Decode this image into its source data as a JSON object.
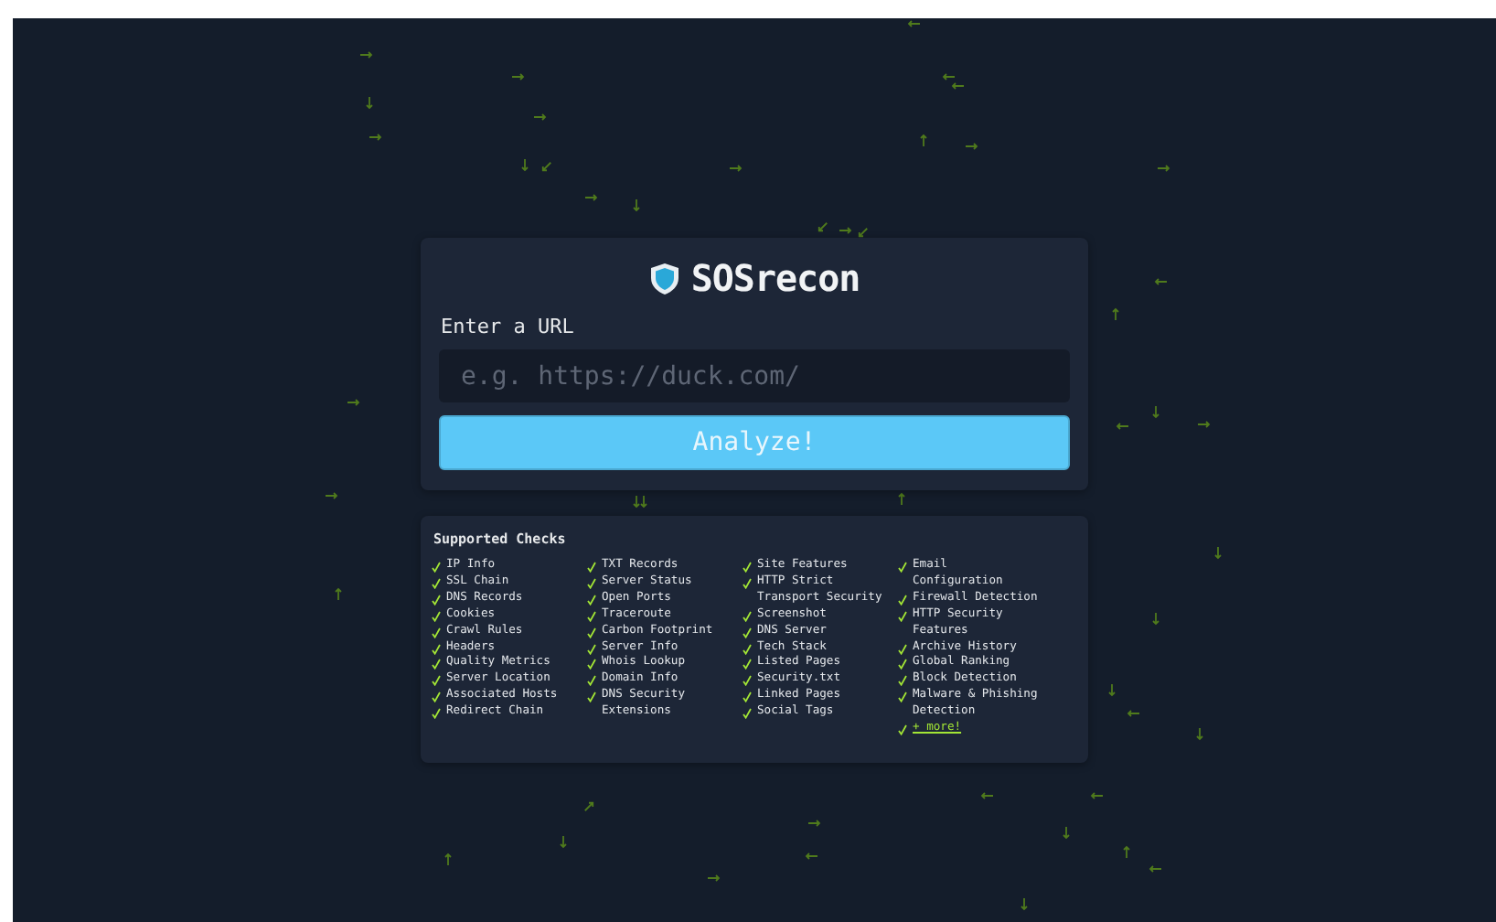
{
  "app": {
    "title": "SOSrecon"
  },
  "url_form": {
    "label": "Enter a URL",
    "placeholder": "e.g. https://duck.com/",
    "button": "Analyze!"
  },
  "checks": {
    "title": "Supported Checks",
    "columns": [
      [
        {
          "label": "IP Info",
          "kind": "item"
        },
        {
          "label": "SSL Chain",
          "kind": "item"
        },
        {
          "label": "DNS Records",
          "kind": "item"
        },
        {
          "label": "Cookies",
          "kind": "item"
        },
        {
          "label": "Crawl Rules",
          "kind": "item"
        },
        {
          "label": "Headers",
          "kind": "item"
        },
        {
          "label": "Quality Metrics",
          "kind": "item"
        },
        {
          "label": "Server Location",
          "kind": "item"
        },
        {
          "label": "Associated Hosts",
          "kind": "item"
        },
        {
          "label": "Redirect Chain",
          "kind": "item"
        }
      ],
      [
        {
          "label": "TXT Records",
          "kind": "item"
        },
        {
          "label": "Server Status",
          "kind": "item"
        },
        {
          "label": "Open Ports",
          "kind": "item"
        },
        {
          "label": "Traceroute",
          "kind": "item"
        },
        {
          "label": "Carbon Footprint",
          "kind": "item"
        },
        {
          "label": "Server Info",
          "kind": "item"
        },
        {
          "label": "Whois Lookup",
          "kind": "item"
        },
        {
          "label": "Domain Info",
          "kind": "item"
        },
        {
          "label": "DNS Security Extensions",
          "kind": "item"
        }
      ],
      [
        {
          "label": "Site Features",
          "kind": "item"
        },
        {
          "label": "HTTP Strict Transport Security",
          "kind": "item"
        },
        {
          "label": "Screenshot",
          "kind": "item"
        },
        {
          "label": "DNS Server",
          "kind": "item"
        },
        {
          "label": "Tech Stack",
          "kind": "item"
        },
        {
          "label": "Listed Pages",
          "kind": "item"
        },
        {
          "label": "Security.txt",
          "kind": "item"
        },
        {
          "label": "Linked Pages",
          "kind": "item"
        },
        {
          "label": "Social Tags",
          "kind": "item"
        }
      ],
      [
        {
          "label": "Email Configuration",
          "kind": "item"
        },
        {
          "label": "Firewall Detection",
          "kind": "item"
        },
        {
          "label": "HTTP Security Features",
          "kind": "item"
        },
        {
          "label": "Archive History",
          "kind": "item"
        },
        {
          "label": "Global Ranking",
          "kind": "item"
        },
        {
          "label": "Block Detection",
          "kind": "item"
        },
        {
          "label": "Malware & Phishing Detection",
          "kind": "item"
        },
        {
          "label": "+ more!",
          "kind": "link"
        }
      ]
    ]
  }
}
